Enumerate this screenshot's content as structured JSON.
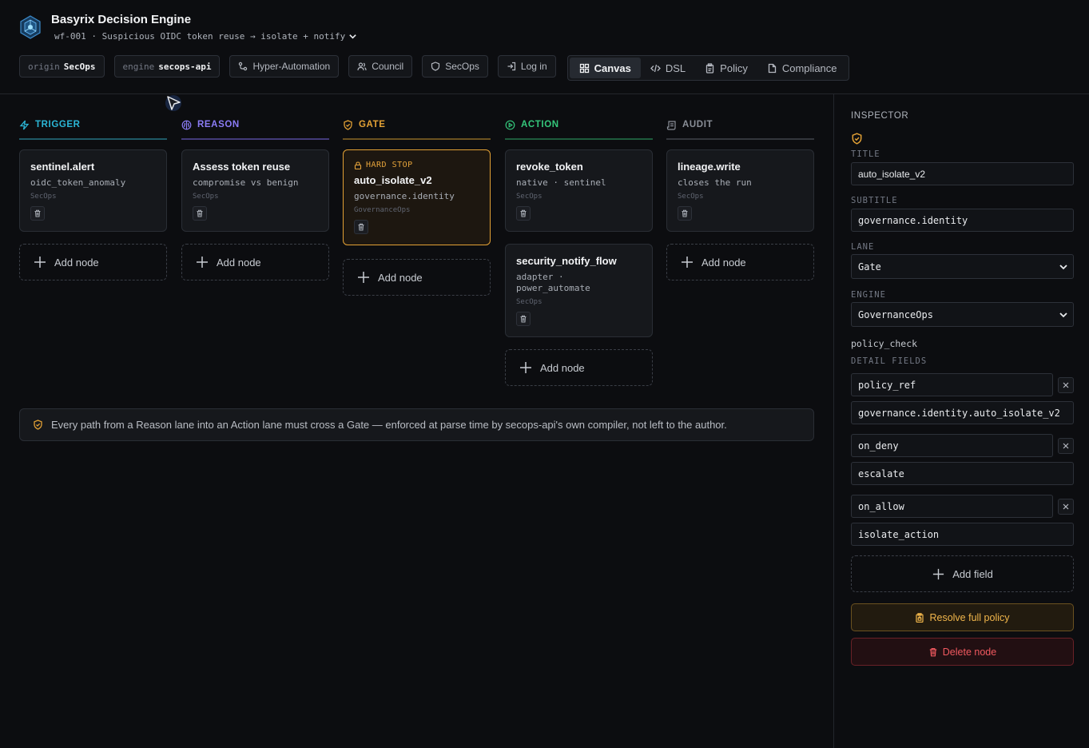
{
  "app": {
    "title": "Basyrix Decision Engine",
    "workflow": "wf-001 · Suspicious OIDC token reuse → isolate + notify"
  },
  "toolbar": {
    "origin_key": "origin",
    "origin_val": "SecOps",
    "engine_key": "engine",
    "engine_val": "secops-api",
    "hyper": "Hyper-Automation",
    "council": "Council",
    "secops": "SecOps",
    "login": "Log in",
    "tabs": [
      "Canvas",
      "DSL",
      "Policy",
      "Compliance"
    ],
    "active_tab": "Canvas"
  },
  "lanes": [
    {
      "name": "TRIGGER",
      "color": "#2bb6d6",
      "cards": [
        {
          "title": "sentinel.alert",
          "subtitle": "oidc_token_anomaly",
          "engine": "SecOps"
        }
      ],
      "add_label": "Add node"
    },
    {
      "name": "REASON",
      "color": "#8b7cf6",
      "cards": [
        {
          "title": "Assess token reuse",
          "subtitle": "compromise vs benign",
          "engine": "SecOps"
        }
      ],
      "add_label": "Add node"
    },
    {
      "name": "GATE",
      "color": "#e3a135",
      "cards": [
        {
          "badge": "HARD STOP",
          "title": "auto_isolate_v2",
          "subtitle": "governance.identity",
          "engine": "GovernanceOps"
        }
      ],
      "add_label": "Add node"
    },
    {
      "name": "ACTION",
      "color": "#34c77b",
      "cards": [
        {
          "title": "revoke_token",
          "subtitle": "native · sentinel",
          "engine": "SecOps"
        },
        {
          "title": "security_notify_flow",
          "subtitle": "adapter · power_automate",
          "engine": "SecOps"
        }
      ],
      "add_label": "Add node"
    },
    {
      "name": "AUDIT",
      "color": "#8a8f98",
      "cards": [
        {
          "title": "lineage.write",
          "subtitle": "closes the run",
          "engine": "SecOps"
        }
      ],
      "add_label": "Add node"
    }
  ],
  "notice": "Every path from a Reason lane into an Action lane must cross a Gate — enforced at parse time by secops-api's own compiler, not left to the author.",
  "inspector": {
    "heading": "INSPECTOR",
    "title_label": "TITLE",
    "title_value": "auto_isolate_v2",
    "subtitle_label": "SUBTITLE",
    "subtitle_value": "governance.identity",
    "lane_label": "LANE",
    "lane_value": "Gate",
    "engine_label": "ENGINE",
    "engine_value": "GovernanceOps",
    "kind": "policy_check",
    "detail_label": "DETAIL FIELDS",
    "fields": [
      {
        "key": "policy_ref",
        "value": "governance.identity.auto_isolate_v2"
      },
      {
        "key": "on_deny",
        "value": "escalate"
      },
      {
        "key": "on_allow",
        "value": "isolate_action"
      }
    ],
    "add_field": "Add field",
    "resolve": "Resolve full policy",
    "delete": "Delete node"
  },
  "colors": {
    "accent_gate": "#e3a135",
    "danger": "#f1595f",
    "background": "#0c0d10"
  }
}
